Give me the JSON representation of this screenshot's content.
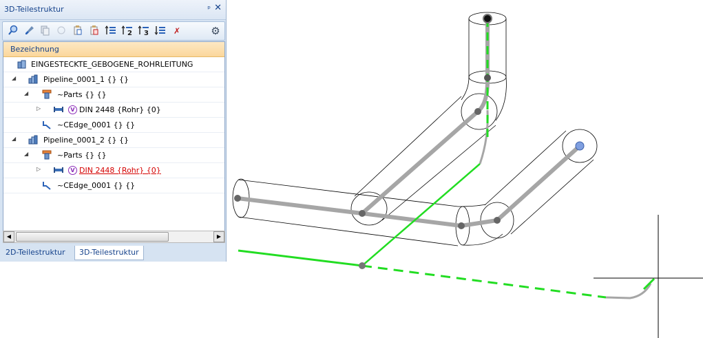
{
  "panel": {
    "title": "3D-Teilestruktur",
    "pin_glyph": "ᵖ",
    "close_glyph": "✕",
    "toolbar_icons": [
      "magnifier-icon",
      "brush-icon",
      "copy-icon",
      "circle-icon",
      "paste-icon",
      "paste-special-icon",
      "sort-1-icon",
      "sort-2-icon",
      "sort-3-icon",
      "sort-down-icon",
      "delete-filter-icon",
      "gear-icon"
    ],
    "toolbar_glyphs": {
      "sort2": "2",
      "sort3": "3",
      "gear": "⚙",
      "delete": "✗"
    },
    "column_header": "Bezeichnung",
    "tree": [
      {
        "label": "EINGESTECKTE_GEBOGENE_ROHRLEITUNG",
        "level": 0,
        "icon": "assembly-icon"
      },
      {
        "label": "Pipeline_0001_1 {} {}",
        "level": 1,
        "icon": "pipeline-icon",
        "expander": "◢"
      },
      {
        "label": "~Parts {} {}",
        "level": 2,
        "icon": "parts-icon",
        "expander": "◢"
      },
      {
        "label": "DIN 2448 {Rohr} {0}",
        "level": 3,
        "icon": "pipe-icon",
        "expander": "▷",
        "badge": "V"
      },
      {
        "label": "~CEdge_0001 {} {}",
        "level": 2,
        "icon": "edge-icon"
      },
      {
        "label": "Pipeline_0001_2 {} {}",
        "level": 1,
        "icon": "pipeline-icon",
        "expander": "◢"
      },
      {
        "label": "~Parts {} {}",
        "level": 2,
        "icon": "parts-icon",
        "expander": "◢"
      },
      {
        "label": "DIN 2448 {Rohr} {0}",
        "level": 3,
        "icon": "pipe-icon",
        "expander": "▷",
        "badge": "V",
        "highlight": true
      },
      {
        "label": "~CEdge_0001 {} {}",
        "level": 2,
        "icon": "edge-icon"
      }
    ],
    "scroll_left": "◀",
    "scroll_right": "▶",
    "tabs": [
      {
        "label": "2D-Teilestruktur",
        "active": false
      },
      {
        "label": "3D-Teilestruktur",
        "active": true
      }
    ]
  },
  "colors": {
    "accent": "#15428b",
    "pipe_grey": "#a6a6a6",
    "path_green": "#22dd22",
    "highlight_red": "#d40000"
  }
}
